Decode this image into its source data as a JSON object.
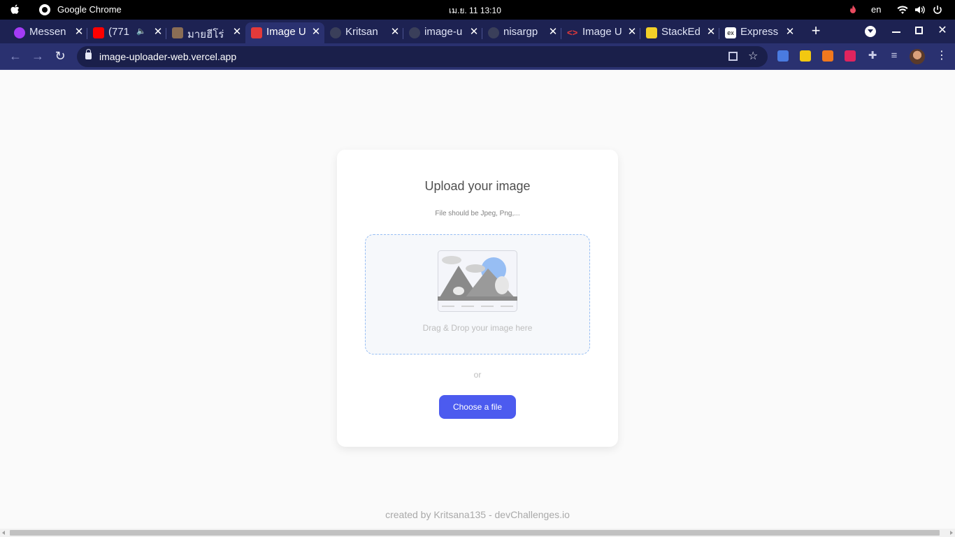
{
  "os": {
    "app_name": "Google Chrome",
    "clock": "เม.ย. 11  13:10",
    "lang": "en"
  },
  "tabs": [
    {
      "label": "Messen",
      "icon": "messenger-icon",
      "color": "#a33bf5"
    },
    {
      "label": "(771",
      "icon": "youtube-icon",
      "color": "#ff0000"
    },
    {
      "label": "มายฮีโร่",
      "icon": "favicon-icon",
      "color": "#8a6d55"
    },
    {
      "label": "Image U",
      "icon": "image-uploader-icon",
      "color": "#e23a3a"
    },
    {
      "label": "Kritsan",
      "icon": "github-icon",
      "color": "#3a3f5a"
    },
    {
      "label": "image-u",
      "icon": "github-icon",
      "color": "#3a3f5a"
    },
    {
      "label": "nisargp",
      "icon": "github-icon",
      "color": "#3a3f5a"
    },
    {
      "label": "Image U",
      "icon": "code-icon",
      "color": "#e23a3a"
    },
    {
      "label": "StackEd",
      "icon": "stackedit-icon",
      "color": "#f2d028"
    },
    {
      "label": "Express",
      "icon": "express-icon",
      "color": "#ffffff"
    }
  ],
  "toolbar": {
    "url": "image-uploader-web.vercel.app"
  },
  "extensions": [
    {
      "icon": "translate-icon",
      "color": "#4a7be0"
    },
    {
      "icon": "notes-icon",
      "color": "#f2c811"
    },
    {
      "icon": "lh-icon",
      "color": "#f0781e"
    },
    {
      "icon": "upload-icon",
      "color": "#e0245e"
    },
    {
      "icon": "puzzle-icon",
      "color": "#c9cce6"
    },
    {
      "icon": "media-icon",
      "color": "#c9cce6"
    }
  ],
  "card": {
    "title": "Upload your image",
    "hint": "File should be Jpeg, Png,...",
    "drop_label": "Drag & Drop your image here",
    "or": "or",
    "button": "Choose a file"
  },
  "footer": "created by Kritsana135 - devChallenges.io",
  "colors": {
    "accent": "#4c5bef",
    "dropzone_border": "#97bef4",
    "tab_strip": "#1d2252",
    "toolbar": "#2a3170"
  }
}
